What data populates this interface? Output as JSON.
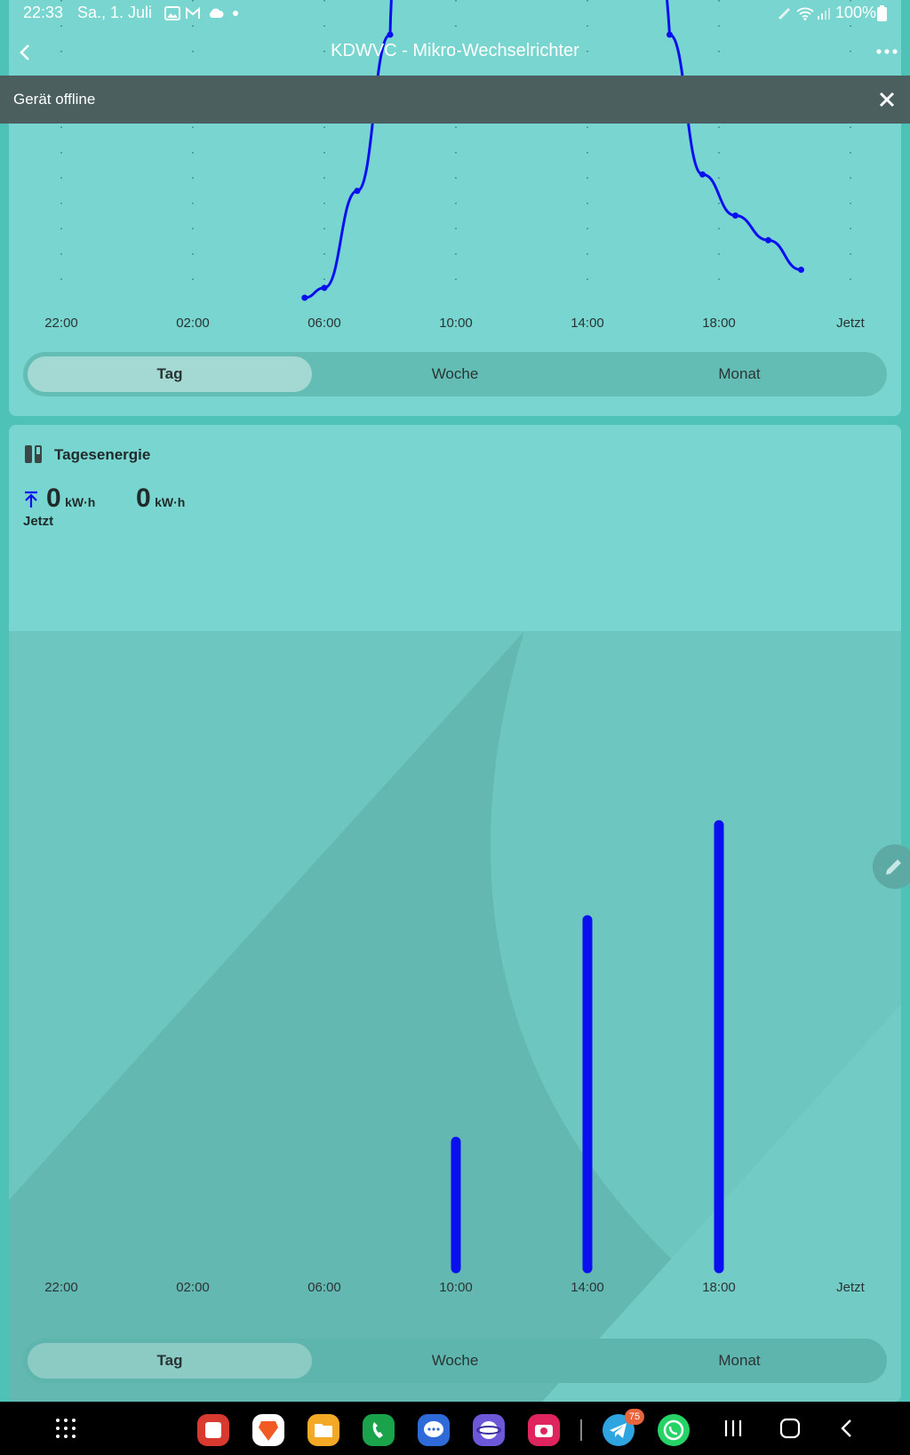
{
  "status_bar": {
    "time": "22:33",
    "date": "Sa., 1. Juli",
    "battery": "100%",
    "icons": [
      "image-icon",
      "gmail-icon",
      "cloud-icon",
      "dot-icon",
      "pen-icon",
      "wifi-icon",
      "signal-icon",
      "battery-icon"
    ]
  },
  "header": {
    "title": "KDWVC - Mikro-Wechselrichter",
    "back_icon": "chevron-left-icon",
    "more_icon": "more-icon"
  },
  "banner": {
    "text": "Gerät offline",
    "close_icon": "close-icon",
    "background": "#4c5f5f"
  },
  "period_tabs": [
    "Tag",
    "Woche",
    "Monat"
  ],
  "active_tab": "Tag",
  "energy_card": {
    "title": "Tagesenergie",
    "icon": "energy-card-icon",
    "export_value": "0",
    "export_unit": "kW·h",
    "export_label": "Jetzt",
    "import_value": "0",
    "import_unit": "kW·h"
  },
  "colors": {
    "card": "#79d5cf",
    "page": "#4fc2b8",
    "series": "#0a0ff0",
    "active_tab": "#a4d8d3"
  },
  "chart_data": [
    {
      "type": "line",
      "x_ticks": [
        "22:00",
        "02:00",
        "06:00",
        "10:00",
        "14:00",
        "18:00",
        "Jetzt"
      ],
      "x": [
        5.4,
        6.0,
        7.0,
        8.0,
        16.5,
        17.5,
        18.5,
        19.5,
        20.5
      ],
      "y": [
        0,
        0.06,
        0.65,
        1.6,
        1.6,
        0.75,
        0.5,
        0.35,
        0.17
      ],
      "y_visible_range": [
        0,
        1.75
      ],
      "grid": "dotted vertical",
      "note": "curve clipped at top of visible area"
    },
    {
      "type": "bar",
      "categories": [
        "22:00",
        "02:00",
        "06:00",
        "10:00",
        "14:00",
        "18:00",
        "Jetzt"
      ],
      "values": [
        0,
        0,
        0,
        1.0,
        2.75,
        3.5,
        0
      ],
      "ylim": [
        0,
        4
      ]
    }
  ],
  "dock": {
    "apps": [
      "app-drawer-icon",
      "sticky-notes-app",
      "brave-app",
      "files-app",
      "phone-app",
      "messages-app",
      "internet-app",
      "camera-app",
      "telegram-app",
      "whatsapp-app"
    ],
    "telegram_badge": "75",
    "nav_icons": [
      "recents-icon",
      "home-icon",
      "back-nav-icon"
    ]
  }
}
